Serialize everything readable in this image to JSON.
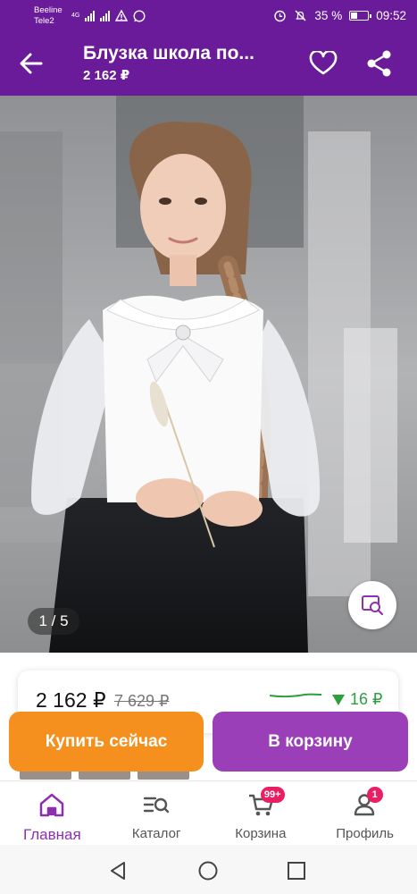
{
  "status_bar": {
    "carrier_1": "Beeline",
    "carrier_2": "Tele2",
    "network_type": "4G",
    "battery_percent": "35 %",
    "battery_level": 0.35,
    "time": "09:52"
  },
  "app_bar": {
    "title": "Блузка школа по...",
    "price": "2 162 ₽",
    "icons": [
      "back-arrow-icon",
      "heart-icon",
      "share-icon"
    ]
  },
  "gallery": {
    "counter": "1 / 5",
    "icons": [
      "visual-search-icon"
    ]
  },
  "price_card": {
    "current_price": "2 162 ₽",
    "old_price": "7 629 ₽",
    "price_change": "16 ₽",
    "colors": {
      "trend": "#2e9f3e"
    }
  },
  "actions": {
    "buy_now_label": "Купить сейчас",
    "add_to_cart_label": "В корзину",
    "colors": {
      "buy_now": "#f5901e",
      "add_to_cart": "#9b3fb8"
    }
  },
  "bottom_nav": {
    "items": [
      {
        "label": "Главная",
        "icon": "home-icon",
        "active": true
      },
      {
        "label": "Каталог",
        "icon": "catalog-search-icon",
        "active": false
      },
      {
        "label": "Корзина",
        "icon": "cart-icon",
        "active": false,
        "badge": "99+"
      },
      {
        "label": "Профиль",
        "icon": "profile-icon",
        "active": false,
        "badge": "1"
      }
    ]
  },
  "system_nav": {
    "icons": [
      "back-triangle-icon",
      "home-circle-icon",
      "recents-square-icon"
    ]
  },
  "theme": {
    "primary": "#6a1b9a",
    "accent": "#8e2fb0",
    "badge": "#e91e63"
  }
}
